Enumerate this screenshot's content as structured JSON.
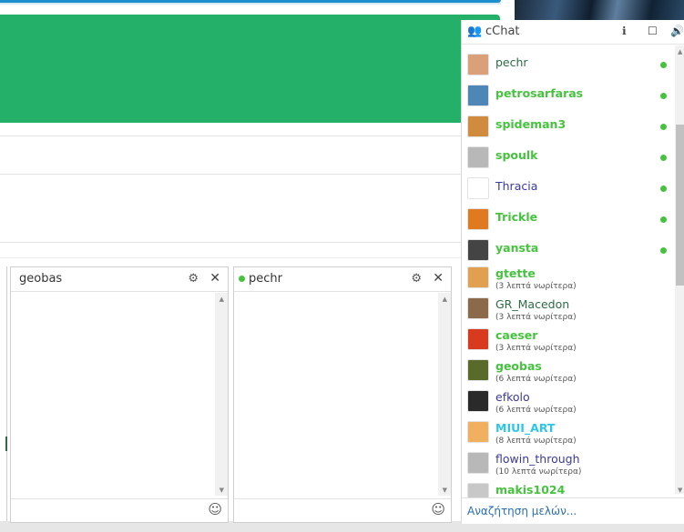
{
  "cchat": {
    "title": "cChat",
    "search_placeholder": "Αναζήτηση μελών...",
    "members": [
      {
        "name": "pechr",
        "color": "#2d6b45",
        "bold": false,
        "online": true,
        "time": "",
        "avatar": "#d9a07a"
      },
      {
        "name": "petrosarfaras",
        "color": "#46c33e",
        "bold": true,
        "online": true,
        "time": "",
        "avatar": "#4f86b8"
      },
      {
        "name": "spideman3",
        "color": "#46c33e",
        "bold": true,
        "online": true,
        "time": "",
        "avatar": "#d08b3f"
      },
      {
        "name": "spoulk",
        "color": "#46c33e",
        "bold": true,
        "online": true,
        "time": "",
        "avatar": "#b8b8b8"
      },
      {
        "name": "Thracia",
        "color": "#3a3a9a",
        "bold": false,
        "online": true,
        "time": "",
        "avatar": "#ffffff"
      },
      {
        "name": "Trickle",
        "color": "#46c33e",
        "bold": true,
        "online": true,
        "time": "",
        "avatar": "#e07a20"
      },
      {
        "name": "yansta",
        "color": "#46c33e",
        "bold": true,
        "online": true,
        "time": "",
        "avatar": "#444444"
      },
      {
        "name": "gtette",
        "color": "#46c33e",
        "bold": true,
        "online": false,
        "time": "(3 λεπτά νωρίτερα)",
        "avatar": "#e0a050"
      },
      {
        "name": "GR_Macedon",
        "color": "#2d6b45",
        "bold": false,
        "online": false,
        "time": "(3 λεπτά νωρίτερα)",
        "avatar": "#8a6a4a"
      },
      {
        "name": "caeser",
        "color": "#46c33e",
        "bold": true,
        "online": false,
        "time": "(3 λεπτά νωρίτερα)",
        "avatar": "#d83a1e"
      },
      {
        "name": "geobas",
        "color": "#46c33e",
        "bold": true,
        "online": false,
        "time": "(6 λεπτά νωρίτερα)",
        "avatar": "#5a6a2a"
      },
      {
        "name": "efkolo",
        "color": "#3a3a9a",
        "bold": false,
        "online": false,
        "time": "(6 λεπτά νωρίτερα)",
        "avatar": "#2a2a2a"
      },
      {
        "name": "MIUI_ART",
        "color": "#2ec6e8",
        "bold": true,
        "online": false,
        "time": "(8 λεπτά νωρίτερα)",
        "avatar": "#f0b060"
      },
      {
        "name": "flowin_through",
        "color": "#3a3a9a",
        "bold": false,
        "online": false,
        "time": "(10 λεπτά νωρίτερα)",
        "avatar": "#b8b8b8"
      },
      {
        "name": "makis1024",
        "color": "#46c33e",
        "bold": true,
        "online": false,
        "time": "",
        "avatar": "#c8c8c8"
      }
    ]
  },
  "chats": [
    {
      "name": "geobas",
      "online": false
    },
    {
      "name": "pechr",
      "online": true
    }
  ]
}
